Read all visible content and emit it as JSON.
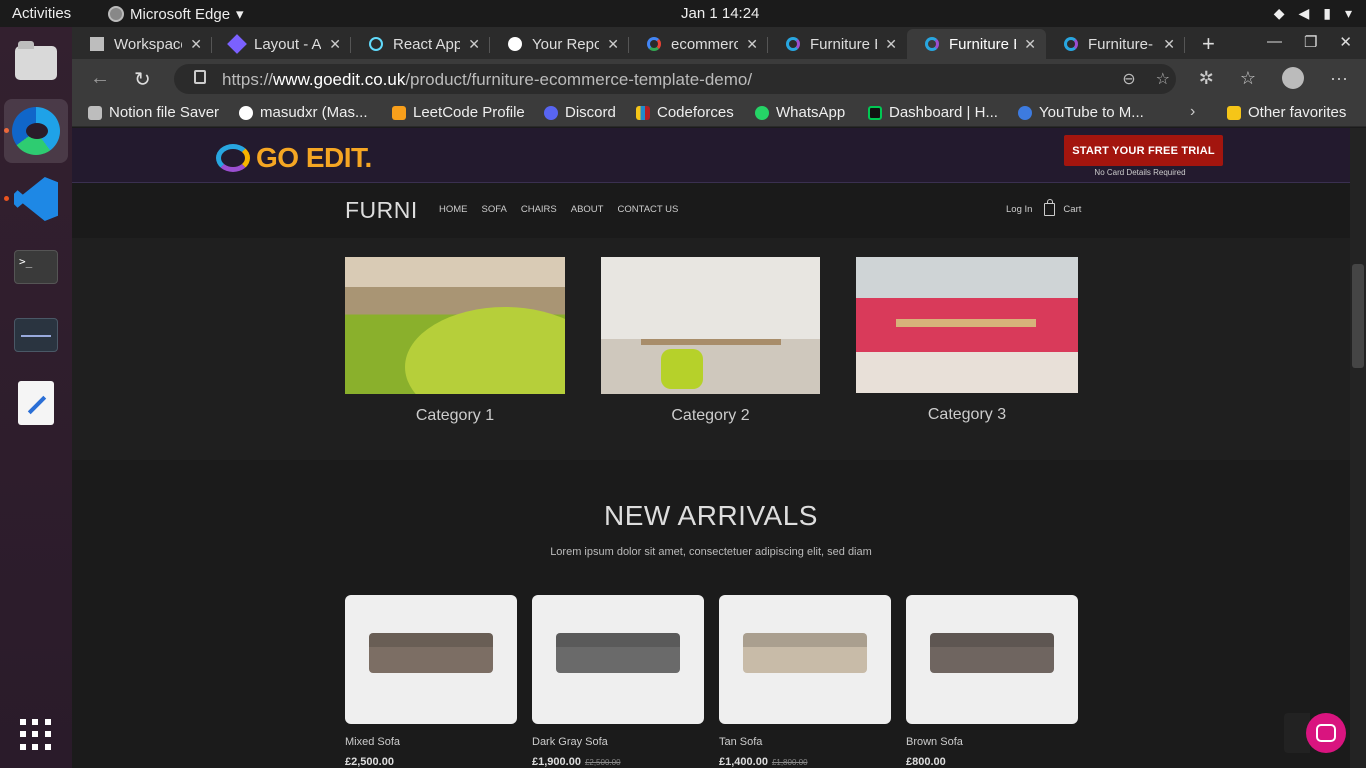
{
  "system": {
    "activities": "Activities",
    "app_name": "Microsoft Edge",
    "clock": "Jan 1  14:24"
  },
  "tabs": [
    {
      "title": "Workspace",
      "icon_color": "#bdbdbd"
    },
    {
      "title": "Layout - Ar",
      "icon_color": "#7b61ff"
    },
    {
      "title": "React App",
      "icon_color": "#61dafb"
    },
    {
      "title": "Your Repos",
      "icon_color": "#ffffff"
    },
    {
      "title": "ecommerce",
      "icon_color": "#4285f4"
    },
    {
      "title": "Furniture E",
      "icon_color": "#9b4fd1"
    },
    {
      "title": "Furniture E",
      "icon_color": "#9b4fd1",
      "active": true
    },
    {
      "title": "Furniture-",
      "icon_color": "#9b4fd1"
    }
  ],
  "address": {
    "scheme": "https://",
    "domain": "www.goedit.co.uk",
    "path": "/product/furniture-ecommerce-template-demo/"
  },
  "favorites": [
    {
      "label": "Notion file Saver",
      "color": "#bdbdbd"
    },
    {
      "label": "masudxr (Mas...",
      "color": "#ffffff"
    },
    {
      "label": "LeetCode Profile",
      "color": "#f89f1b"
    },
    {
      "label": "Discord",
      "color": "#5865f2"
    },
    {
      "label": "Codeforces",
      "color": "#1f8acb"
    },
    {
      "label": "WhatsApp",
      "color": "#25d366"
    },
    {
      "label": "Dashboard | H...",
      "color": "#00c853"
    },
    {
      "label": "YouTube to M...",
      "color": "#3d7be0"
    }
  ],
  "other_favorites": "Other favorites",
  "goedit": {
    "logo": "GO EDIT.",
    "trial_button": "START YOUR FREE TRIAL",
    "trial_note": "No Card Details Required"
  },
  "site": {
    "brand": "FURNI",
    "menu": [
      "HOME",
      "SOFA",
      "CHAIRS",
      "ABOUT",
      "CONTACT US"
    ],
    "login": "Log In",
    "cart": "Cart"
  },
  "categories": [
    {
      "label": "Category 1"
    },
    {
      "label": "Category 2"
    },
    {
      "label": "Category 3"
    }
  ],
  "arrivals": {
    "title": "NEW ARRIVALS",
    "subtitle": "Lorem ipsum dolor sit amet, consectetuer adipiscing elit, sed diam",
    "products": [
      {
        "name": "Mixed Sofa",
        "price": "£2,500.00",
        "old_price": "",
        "color": "#7c6e64"
      },
      {
        "name": "Dark Gray Sofa",
        "price": "£1,900.00",
        "old_price": "£2,500.00",
        "color": "#6a6a6a"
      },
      {
        "name": "Tan Sofa",
        "price": "£1,400.00",
        "old_price": "£1,800.00",
        "color": "#c8bba8"
      },
      {
        "name": "Brown Sofa",
        "price": "£800.00",
        "old_price": "",
        "color": "#6f6560"
      }
    ]
  }
}
